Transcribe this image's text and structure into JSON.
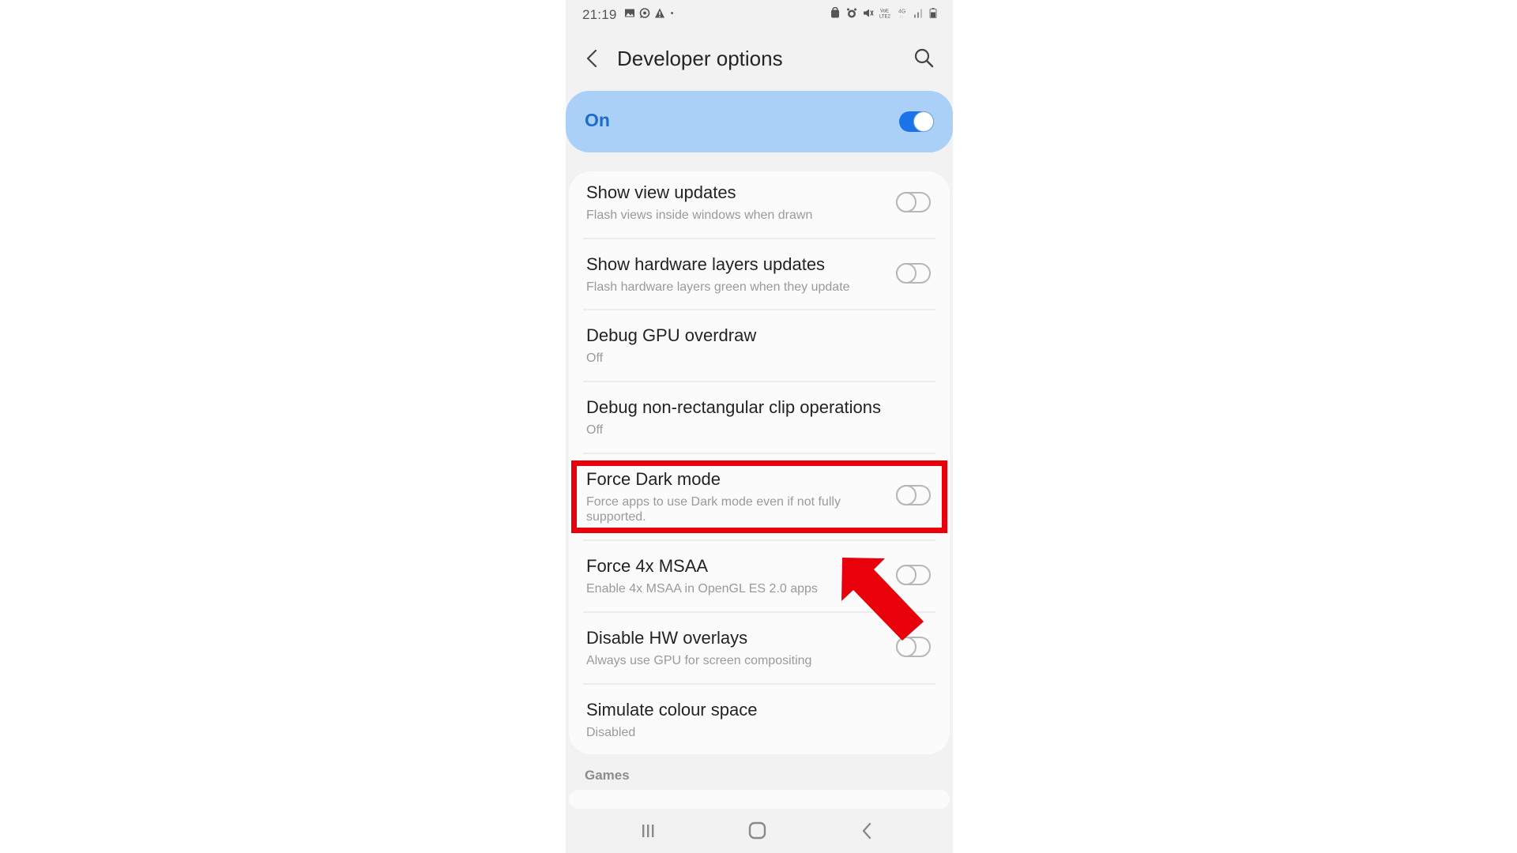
{
  "status_bar": {
    "time": "21:19",
    "left_icons": [
      "gallery-icon",
      "whatsapp-icon",
      "warning-icon",
      "dot-icon"
    ],
    "right_icons": [
      "data-saver-icon",
      "alarm-icon",
      "mute-icon",
      "volte2-icon",
      "4g-icon",
      "signal-icon",
      "battery-icon"
    ]
  },
  "header": {
    "title": "Developer options",
    "back_icon": "chevron-left-icon",
    "search_icon": "search-icon"
  },
  "master_switch": {
    "label": "On",
    "state": true
  },
  "settings": [
    {
      "title": "Show view updates",
      "subtitle": "Flash views inside windows when drawn",
      "has_toggle": true,
      "toggle_state": false
    },
    {
      "title": "Show hardware layers updates",
      "subtitle": "Flash hardware layers green when they update",
      "has_toggle": true,
      "toggle_state": false
    },
    {
      "title": "Debug GPU overdraw",
      "subtitle": "Off",
      "has_toggle": false
    },
    {
      "title": "Debug non-rectangular clip operations",
      "subtitle": "Off",
      "has_toggle": false
    },
    {
      "title": "Force Dark mode",
      "subtitle": "Force apps to use Dark mode even if not fully supported.",
      "has_toggle": true,
      "toggle_state": false,
      "highlighted": true
    },
    {
      "title": "Force 4x MSAA",
      "subtitle": "Enable 4x MSAA in OpenGL ES 2.0 apps",
      "has_toggle": true,
      "toggle_state": false
    },
    {
      "title": "Disable HW overlays",
      "subtitle": "Always use GPU for screen compositing",
      "has_toggle": true,
      "toggle_state": false
    },
    {
      "title": "Simulate colour space",
      "subtitle": "Disabled",
      "has_toggle": false
    }
  ],
  "section_header": "Games",
  "navbar": {
    "buttons": [
      "recents-icon",
      "home-icon",
      "back-icon"
    ]
  },
  "annotation": {
    "highlight_color": "#e8000b",
    "arrow_color": "#e8000b",
    "highlighted_item": "Force Dark mode"
  },
  "colors": {
    "accent": "#1a73e8",
    "master_bg": "#aad0f7",
    "screen_bg": "#f2f2f2",
    "card_bg": "#fbfbfb"
  }
}
